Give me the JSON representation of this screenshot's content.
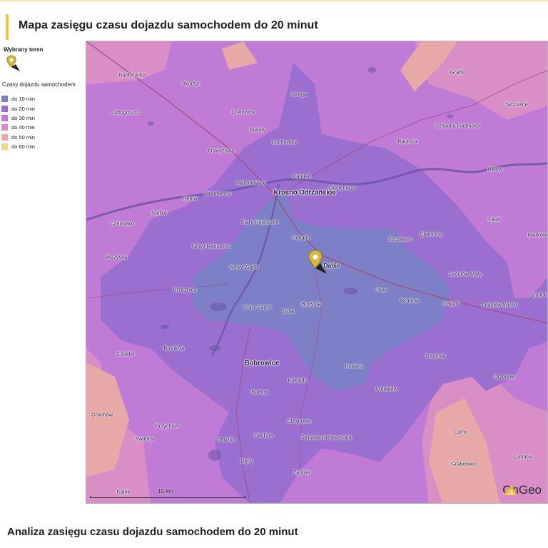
{
  "page": {
    "title": "Mapa zasięgu czasu dojazdu samochodem do 20 minut",
    "section_title": "Analiza zasięgu czasu dojazdu samochodem do 20 minut"
  },
  "legend": {
    "selected_title": "Wybrany teren",
    "times_title": "Czasy dojazdu samochodem",
    "items": [
      {
        "label": "do 10 min",
        "color": "#7d7fc7"
      },
      {
        "label": "do 20 min",
        "color": "#9a6fd0"
      },
      {
        "label": "do 30 min",
        "color": "#c07bd6"
      },
      {
        "label": "do 40 min",
        "color": "#d98fc6"
      },
      {
        "label": "do 50 min",
        "color": "#e7a8a8"
      },
      {
        "label": "do 60 min",
        "color": "#efd78c"
      }
    ]
  },
  "map": {
    "marker_label": "Dąbie",
    "places": [
      "Radomicko",
      "Skórzyn",
      "Struga",
      "Grabin",
      "Lubogoszcz",
      "Cretowice",
      "Sycowice",
      "Szklarka Radnicka",
      "Bielów",
      "Łochowice",
      "Radnica",
      "Osiecznica",
      "Bełów",
      "Kamień",
      "Marcinowice",
      "Retno",
      "Strumienno",
      "Krosno Odrzańskie",
      "Gostchorze",
      "Sarbia",
      "Łaski",
      "Czarnowo",
      "Stary Raduszec",
      "Nietków",
      "Połupin",
      "Szczawno",
      "Ciemnice",
      "Nowy Raduszec",
      "Wężyska",
      "Nowy Zagór",
      "Leśniów Mały",
      "Brzeźnica",
      "Pław",
      "Gronów",
      "Łagów",
      "Leśniów Wielki",
      "Sudoł",
      "Budynia",
      "Stary Zagór",
      "Gola",
      "Bronków",
      "Czeklin",
      "Bobrowice",
      "Trzebule",
      "Kosierz",
      "Drzonów",
      "Kukadło",
      "Barłogi",
      "Łubiatów",
      "Grochów",
      "Chojnowo",
      "Przychów",
      "Lipno",
      "Dachów",
      "Tarnawa Krośnieńska",
      "Wełnice",
      "Strużka",
      "Letnica",
      "Dęby",
      "Grabowiec",
      "Żarków",
      "Kałek"
    ],
    "scale_label": "10 km",
    "brand": "OnGeo",
    "colors": {
      "z10": "#7d7fc7",
      "z20": "#9a6fd0",
      "z30": "#c07bd6",
      "z40": "#d98fc6",
      "z50": "#e7a8a8",
      "river": "#6b55a8",
      "road": "#9c4f7a"
    }
  }
}
